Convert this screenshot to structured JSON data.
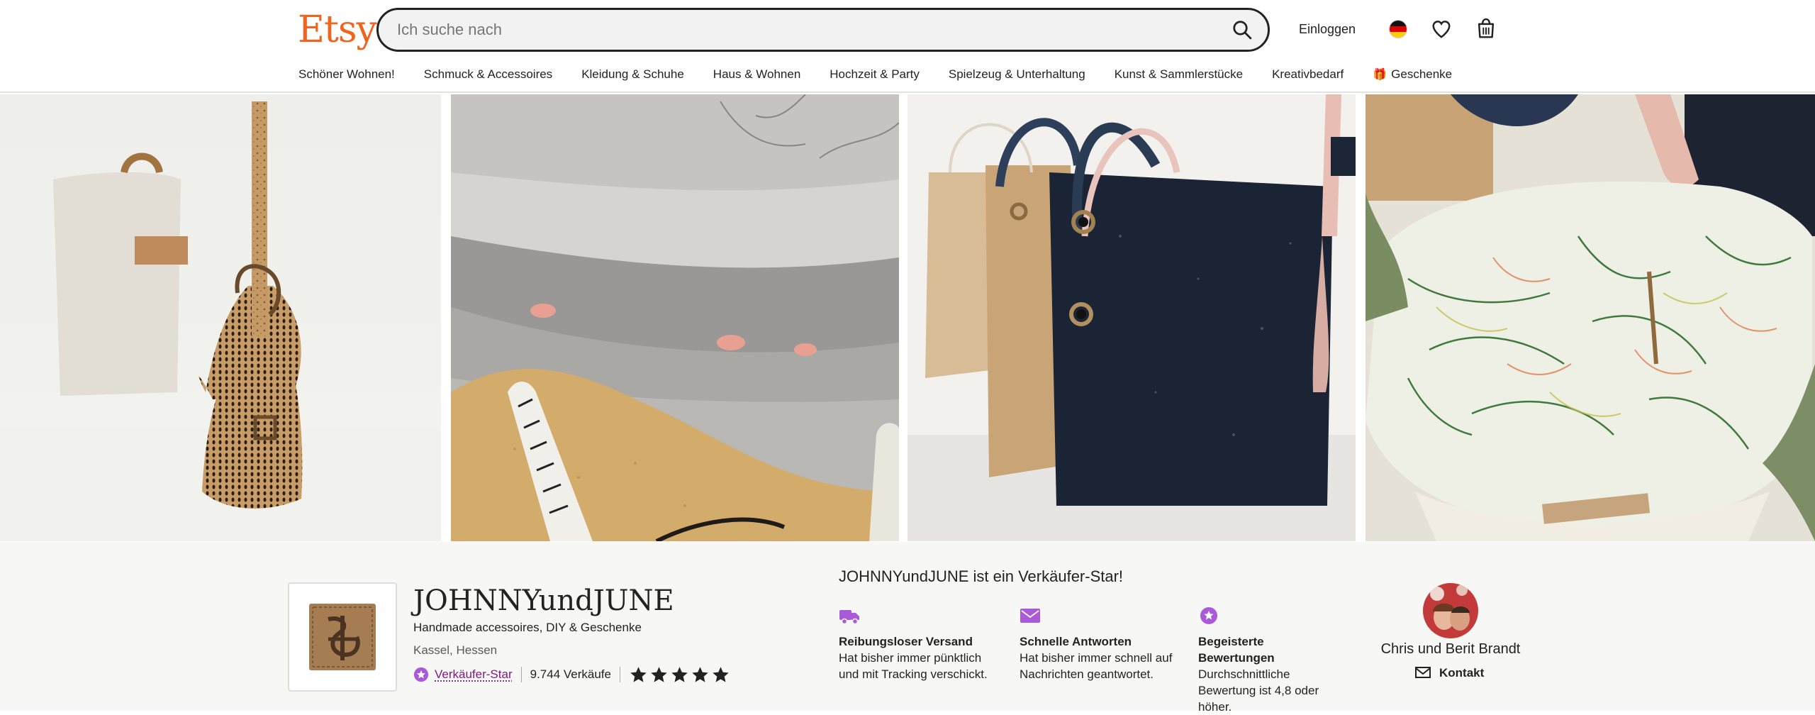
{
  "header": {
    "logo": "Etsy",
    "search_placeholder": "Ich suche nach",
    "login_label": "Einloggen"
  },
  "nav": {
    "categories": [
      "Schöner Wohnen!",
      "Schmuck & Accessoires",
      "Kleidung & Schuhe",
      "Haus & Wohnen",
      "Hochzeit & Party",
      "Spielzeug & Unterhaltung",
      "Kunst & Sammlerstücke",
      "Kreativbedarf",
      "Geschenke"
    ]
  },
  "shop": {
    "name": "JOHNNYundJUNE",
    "tagline": "Handmade accessoires, DIY & Geschenke",
    "location": "Kassel, Hessen",
    "star_seller_label": "Verkäufer-Star",
    "sales": "9.744 Verkäufe",
    "rating_stars": 5
  },
  "star_seller": {
    "title": "JOHNNYundJUNE ist ein Verkäufer-Star!",
    "features": [
      {
        "title": "Reibungsloser Versand",
        "desc": "Hat bisher immer pünktlich und mit Tracking verschickt.",
        "icon": "truck-icon"
      },
      {
        "title": "Schnelle Antworten",
        "desc": "Hat bisher immer schnell auf Nachrichten geantwortet.",
        "icon": "mail-icon"
      },
      {
        "title": "Begeisterte Bewertungen",
        "desc": "Durchschnittliche Bewertung ist 4,8 oder höher.",
        "icon": "star-badge-icon"
      }
    ]
  },
  "owner": {
    "name": "Chris und Berit Brandt",
    "contact_label": "Kontakt"
  },
  "colors": {
    "brand": "#f1641e",
    "star_seller": "#7f187f",
    "feature_icon": "#a95ad8"
  }
}
